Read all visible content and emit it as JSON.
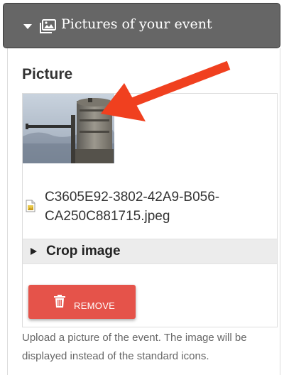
{
  "section": {
    "title": "Pictures of your event",
    "expanded": true,
    "icon": "images-icon"
  },
  "field": {
    "label": "Picture"
  },
  "file": {
    "name": "C3605E92-3802-42A9-B056-CA250C881715.jpeg",
    "icon": "image-file-icon"
  },
  "crop": {
    "label": "Crop image",
    "expanded": false
  },
  "actions": {
    "remove_label": "REMOVE",
    "remove_color": "#e5534a"
  },
  "help": {
    "description": "Upload a picture of the event. The image will be displayed instead of the standard icons."
  },
  "annotation": {
    "arrow_color": "#f0401f"
  },
  "colors": {
    "header_bg": "#666666",
    "crop_bar_bg": "#ececec"
  }
}
